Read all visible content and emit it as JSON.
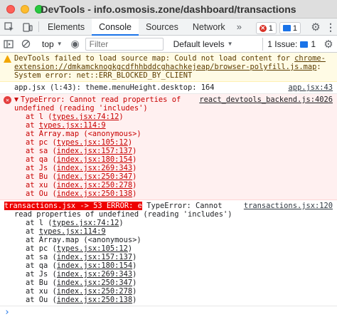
{
  "window": {
    "title": "DevTools - info.osmosis.zone/dashboard/transactions"
  },
  "tabs": {
    "items": [
      "Elements",
      "Console",
      "Sources",
      "Network"
    ],
    "active": "Console",
    "error_count": "1",
    "message_count": "1",
    "more_label": "»"
  },
  "toolbar": {
    "context": "top",
    "filter_placeholder": "Filter",
    "levels_label": "Default levels",
    "issues_label": "1 Issue:",
    "issues_count": "1"
  },
  "console": {
    "warning": {
      "text_prefix": "DevTools failed to load source map: Could not load content for ",
      "url": "chrome-extension://dmkamcknogkgcdfhhbddcghachkejeap/browser-polyfill.js.map",
      "suffix": ": System error: net::ERR_BLOCKED_BY_CLIENT"
    },
    "log": {
      "text": "app.jsx (l:43): theme.menuHeight.desktop: 164",
      "source": "app.jsx:43"
    },
    "error1": {
      "message": "TypeError: Cannot read properties of undefined (reading 'includes')",
      "source": "react_devtools_backend.js:4026",
      "stack": [
        {
          "prefix": "at l (",
          "link": "types.jsx:74:12",
          "suffix": ")"
        },
        {
          "prefix": "at ",
          "link": "types.jsx:114:9",
          "suffix": ""
        },
        {
          "prefix": "at Array.map (<anonymous>)",
          "link": "",
          "suffix": ""
        },
        {
          "prefix": "at pc (",
          "link": "types.jsx:105:12",
          "suffix": ")"
        },
        {
          "prefix": "at sa (",
          "link": "index.jsx:157:137",
          "suffix": ")"
        },
        {
          "prefix": "at qa (",
          "link": "index.jsx:180:154",
          "suffix": ")"
        },
        {
          "prefix": "at Js (",
          "link": "index.jsx:269:343",
          "suffix": ")"
        },
        {
          "prefix": "at Bu (",
          "link": "index.jsx:250:347",
          "suffix": ")"
        },
        {
          "prefix": "at xu (",
          "link": "index.jsx:250:278",
          "suffix": ")"
        },
        {
          "prefix": "at Ou (",
          "link": "index.jsx:250:138",
          "suffix": ")"
        }
      ]
    },
    "error2": {
      "label": "transactions.jsx -> 53 ERROR: e",
      "message": " TypeError: Cannot read properties of undefined (reading 'includes')",
      "source": "transactions.jsx:120",
      "stack": [
        {
          "prefix": "at l (",
          "link": "types.jsx:74:12",
          "suffix": ")"
        },
        {
          "prefix": "at ",
          "link": "types.jsx:114:9",
          "suffix": ""
        },
        {
          "prefix": "at Array.map (<anonymous>)",
          "link": "",
          "suffix": ""
        },
        {
          "prefix": "at pc (",
          "link": "types.jsx:105:12",
          "suffix": ")"
        },
        {
          "prefix": "at sa (",
          "link": "index.jsx:157:137",
          "suffix": ")"
        },
        {
          "prefix": "at qa (",
          "link": "index.jsx:180:154",
          "suffix": ")"
        },
        {
          "prefix": "at Js (",
          "link": "index.jsx:269:343",
          "suffix": ")"
        },
        {
          "prefix": "at Bu (",
          "link": "index.jsx:250:347",
          "suffix": ")"
        },
        {
          "prefix": "at xu (",
          "link": "index.jsx:250:278",
          "suffix": ")"
        },
        {
          "prefix": "at Ou (",
          "link": "index.jsx:250:138",
          "suffix": ")"
        }
      ]
    },
    "prompt": "›"
  }
}
